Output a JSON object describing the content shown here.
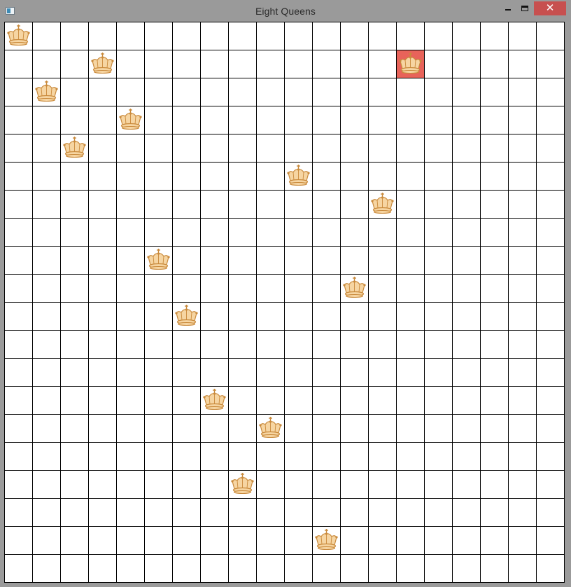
{
  "window": {
    "title": "Eight Queens",
    "close_glyph": "✕"
  },
  "board": {
    "rows": 20,
    "cols": 20,
    "queens": [
      {
        "row": 0,
        "col": 0
      },
      {
        "row": 1,
        "col": 3
      },
      {
        "row": 1,
        "col": 14,
        "highlighted": true
      },
      {
        "row": 2,
        "col": 1
      },
      {
        "row": 3,
        "col": 4
      },
      {
        "row": 4,
        "col": 2
      },
      {
        "row": 5,
        "col": 10
      },
      {
        "row": 6,
        "col": 13
      },
      {
        "row": 8,
        "col": 5
      },
      {
        "row": 9,
        "col": 12
      },
      {
        "row": 10,
        "col": 6
      },
      {
        "row": 13,
        "col": 7
      },
      {
        "row": 14,
        "col": 9
      },
      {
        "row": 16,
        "col": 8
      },
      {
        "row": 18,
        "col": 11
      }
    ],
    "piece_icon": "crown-icon",
    "colors": {
      "cell": "#ffffff",
      "grid_line": "#000000",
      "highlight": "#e8635a",
      "crown_fill": "#f6d5a2",
      "crown_stroke": "#c98a3c"
    }
  }
}
